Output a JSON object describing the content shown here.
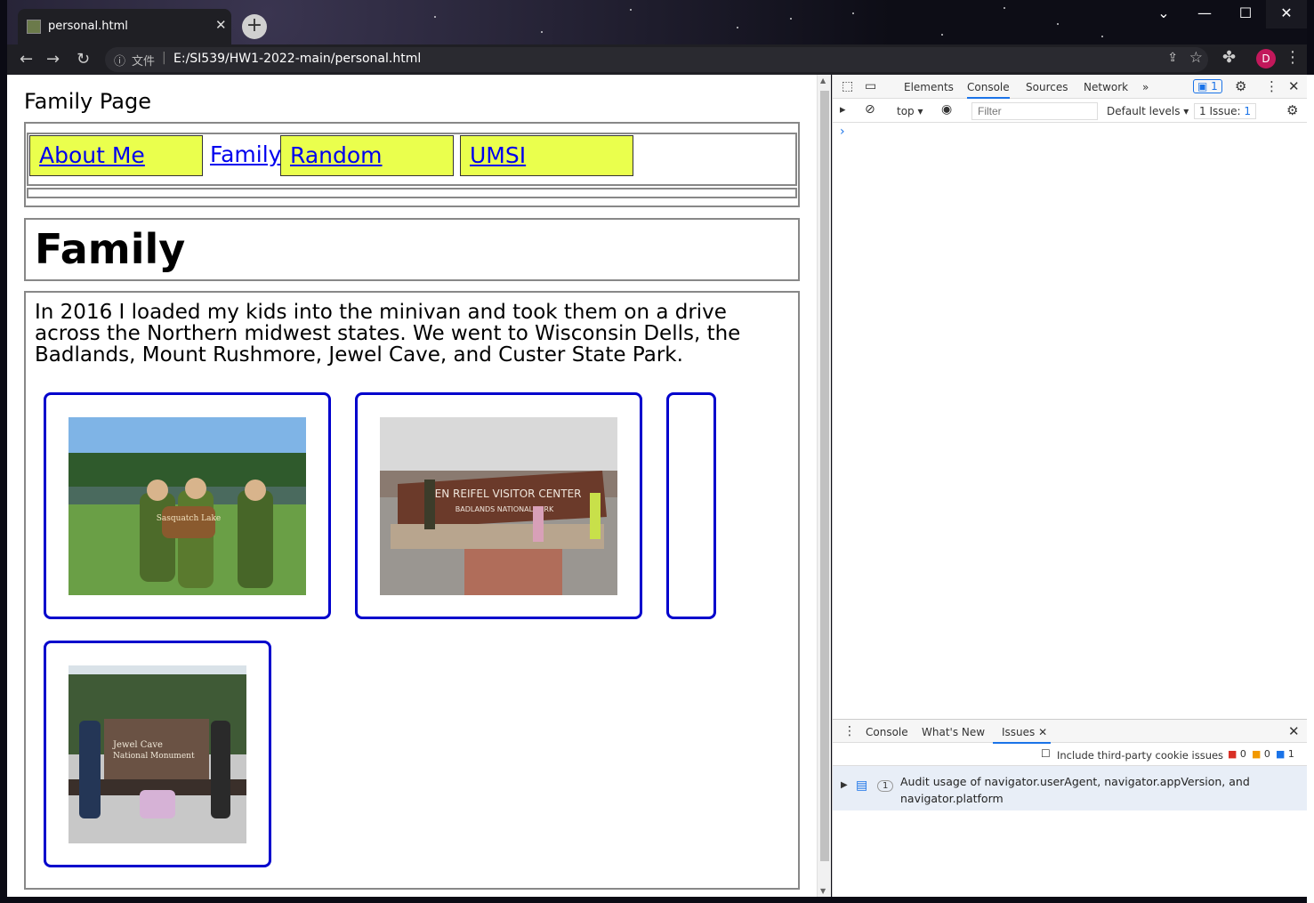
{
  "browser": {
    "tab_title": "personal.html",
    "close_tab": "✕",
    "new_tab": "+",
    "url_scheme_label": "文件",
    "url": "E:/SI539/HW1-2022-main/personal.html",
    "avatar_letter": "D",
    "window_controls": [
      "⌄",
      "—",
      "☐",
      "✕"
    ]
  },
  "page": {
    "site_title": "Family Page",
    "nav": [
      "About Me",
      "Family",
      "Random",
      "UMSI"
    ],
    "heading": "Family",
    "intro": "In 2016 I loaded my kids into the minivan and took them on a drive across the Northern midwest states. We went to Wisconsin Dells, the Badlands, Mount Rushmore, Jewel Cave, and Custer State Park.",
    "photo2_sign_line1": "BEN REIFEL VISITOR CENTER",
    "photo2_sign_line2": "BADLANDS NATIONAL PARK",
    "photo1_sign": "Sasquatch Lake",
    "photo4_sign_line1": "Jewel Cave",
    "photo4_sign_line2": "National Monument"
  },
  "devtools": {
    "tabs": [
      "Elements",
      "Console",
      "Sources",
      "Network"
    ],
    "active_tab": "Console",
    "more": "»",
    "issues_badge": "1",
    "context": "top",
    "filter_placeholder": "Filter",
    "levels": "Default levels",
    "issue_count": "1 Issue:",
    "issue_count_num": "1",
    "prompt": "›",
    "drawer_tabs": [
      "Console",
      "What's New",
      "Issues"
    ],
    "include_third_party": "Include third-party cookie issues",
    "counts": [
      "0",
      "0",
      "1"
    ],
    "issue_num": "1",
    "issue_text": "Audit usage of navigator.userAgent, navigator.appVersion, and navigator.platform"
  }
}
